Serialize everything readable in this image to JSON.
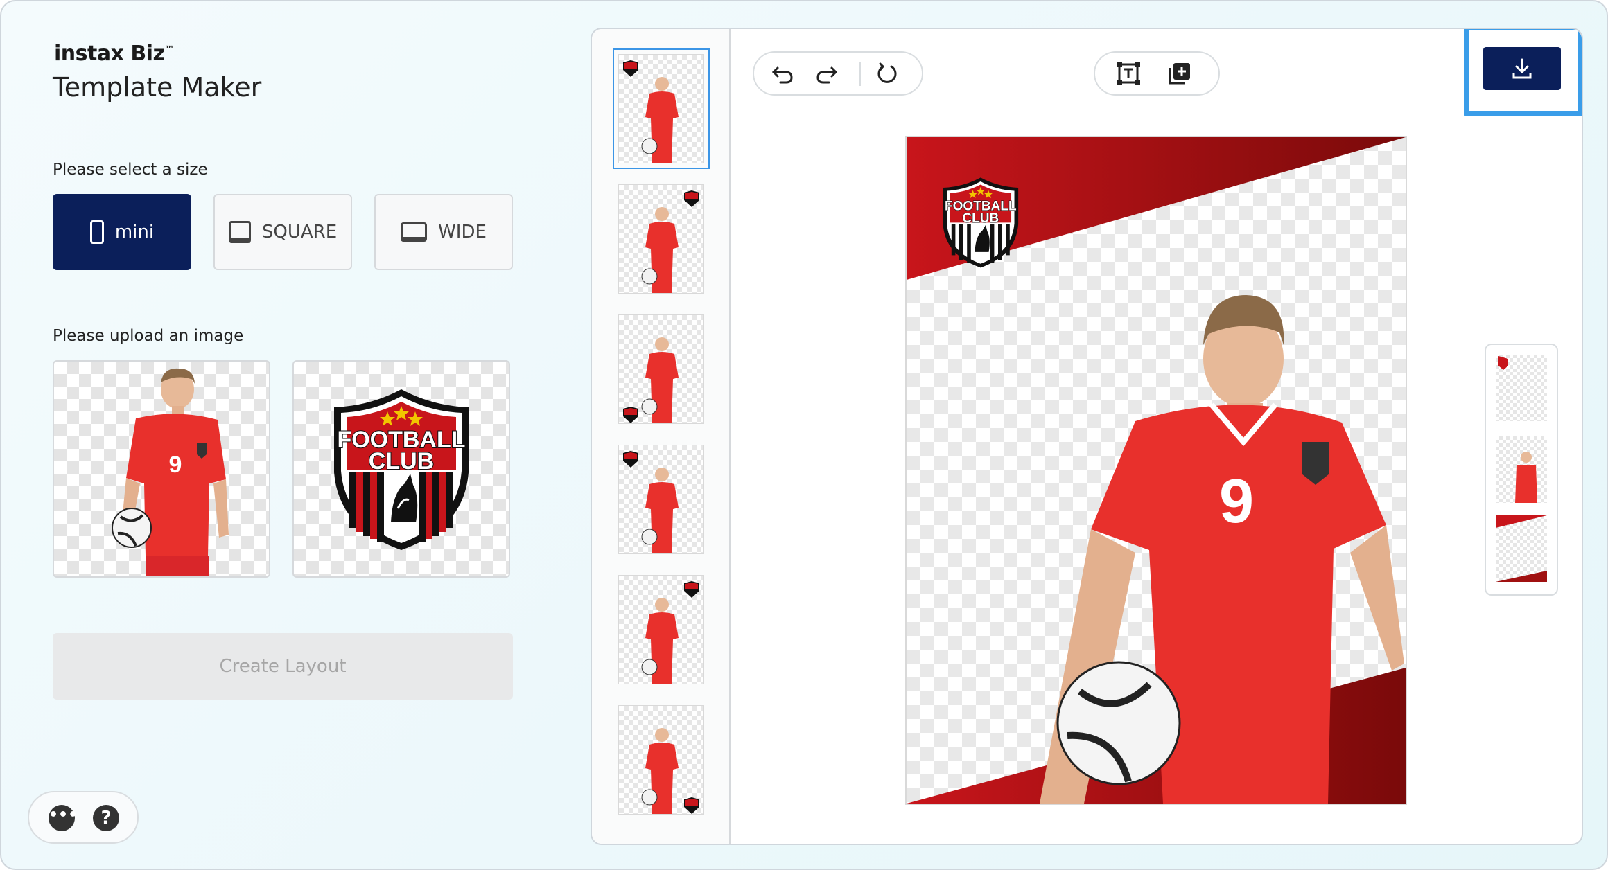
{
  "app": {
    "brand": "instax Biz",
    "brand_mark": "™",
    "title": "Template Maker"
  },
  "size_section": {
    "label": "Please select a size",
    "options": [
      {
        "label": "mini",
        "icon": "phone-portrait-icon",
        "selected": true
      },
      {
        "label": "SQUARE",
        "icon": "square-frame-icon",
        "selected": false
      },
      {
        "label": "WIDE",
        "icon": "wide-frame-icon",
        "selected": false
      }
    ]
  },
  "upload_section": {
    "label": "Please upload an image",
    "images": [
      "player-photo",
      "football-club-logo"
    ]
  },
  "logo": {
    "line1": "FOOTBALL",
    "line2": "CLUB"
  },
  "player": {
    "number": "9"
  },
  "create_button": {
    "label": "Create Layout",
    "enabled": false
  },
  "footer_icons": [
    "more-options-icon",
    "help-icon"
  ],
  "editor": {
    "toolbar": [
      "undo-icon",
      "redo-icon",
      "reset-icon",
      "text-box-icon",
      "add-image-icon"
    ],
    "download_icon": "download-icon",
    "layout_thumbnail_count": 6,
    "selected_thumbnail": 0,
    "layer_count": 3
  },
  "colors": {
    "primary": "#0b1f5a",
    "highlight": "#3a9de9",
    "red": "#c8151b",
    "dark_red": "#8e0e0e",
    "jersey": "#e8302c"
  }
}
